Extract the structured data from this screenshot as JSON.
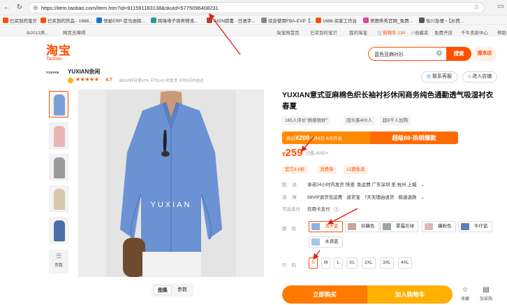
{
  "browser": {
    "url": "https://item.taobao.com/item.htm?id=911591183138&skuId=5775096408231",
    "bookmarks": [
      "已买到的宝贝",
      "已买到的货品 - 1688...",
      "领星ERP-亚马逊跨...",
      "跨境电子商务物流...",
      "AIGN辞書 - 日语字...",
      "欢迎使用FBA-EXP【...",
      "1688-买家工作台",
      "美图秀秀官网_免费...",
      "佐川急便・【お荷..."
    ]
  },
  "site_nav": {
    "left": [
      "tb2013男...",
      "网页无障碍"
    ],
    "right": [
      "淘宝网首页",
      "已买到的宝贝",
      "我的淘宝",
      "购物车 134",
      "收藏夹",
      "免费开店",
      "千牛卖家中心",
      "帮助"
    ]
  },
  "header": {
    "logo_cn": "淘宝",
    "logo_en": "Taobao",
    "search_query": "蓝色亚麻衬衫",
    "search_button": "搜索",
    "shop_button": "搜本店"
  },
  "shop": {
    "logo_text": "YUXIAN",
    "name": "YUXIAN余闲",
    "score": "4.7",
    "meta": "88VIP好评率97%   平均14小时发货   平均3天内送达",
    "service_button": "联系客服",
    "enter_button": "进入店铺"
  },
  "gallery": {
    "watermark": "YUXIAN",
    "params_label": "参数",
    "tabs": [
      "图集",
      "参数"
    ],
    "thumb_colors": [
      "#7aa0d8",
      "#e8b4b8",
      "#9a9a9a",
      "#d8c8b0",
      "#4a6fa8"
    ]
  },
  "product": {
    "title": "YUXIAN意式亚麻棉色织长袖衬衫休闲商务纯色通勤透气吸湿衬衣春夏",
    "chips": [
      "165人评价\"质感很好\"",
      "回头客400人",
      "超8千人加购"
    ],
    "promo_left_prefix": "券后",
    "promo_left_price": "¥209",
    "promo_left_suffix": "3月8日 8点开卖",
    "promo_right": "超级88·热销爆款",
    "price_symbol": "¥",
    "price": "259",
    "sales": "已售 4000+",
    "tags": [
      "官方8.8折",
      "消费券",
      "12期免息"
    ],
    "delivery_label": "配 送",
    "delivery_value": "承诺24小时内发货  快递: 免运费  广东深圳  至  杭州 上城",
    "guarantee_label": "保 障",
    "guarantees": [
      "88VIP退货包运费",
      "退货宝",
      "7天无理由退货",
      "极速退款"
    ],
    "payment_label": "可选支付",
    "payment_value": "信用卡支付",
    "color_label": "颜色",
    "colors": [
      {
        "name": "浅天蓝",
        "swatch": "#8fb0e0"
      },
      {
        "name": "砂藕色",
        "swatch": "#c9a8a0"
      },
      {
        "name": "雾霾灰绿",
        "swatch": "#9aa69a"
      },
      {
        "name": "藕粉色",
        "swatch": "#e0b8b8"
      },
      {
        "name": "牛仔蓝",
        "swatch": "#5a7fb8"
      },
      {
        "name": "水滴蓝",
        "swatch": "#a8c4e8"
      }
    ],
    "size_label": "尺码",
    "sizes": [
      "S",
      "M",
      "L",
      "XL",
      "2XL",
      "3XL",
      "4XL"
    ]
  },
  "actions": {
    "buy_now": "立即购买",
    "add_cart": "加入购物车",
    "favorite": "收藏",
    "compare": "加采购"
  }
}
